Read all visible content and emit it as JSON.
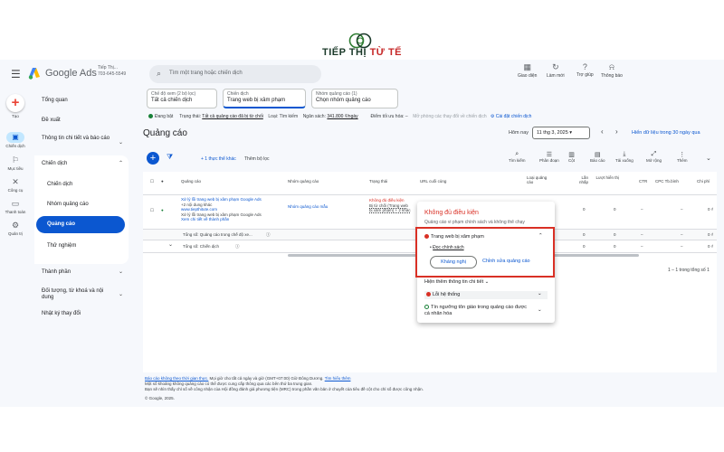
{
  "brand": {
    "name_part1": "TIẾP THỊ ",
    "name_part2": "TỪ TẾ"
  },
  "app": {
    "product_name": "Google Ads",
    "account_name": "Tiếp Thị...",
    "account_id": "703-645-5549",
    "search_placeholder": "Tìm một trang hoặc chiến dịch"
  },
  "top_tools": [
    {
      "icon": "appearance-icon",
      "glyph": "▦",
      "label": "Giao diện"
    },
    {
      "icon": "refresh-icon",
      "glyph": "↻",
      "label": "Làm mới"
    },
    {
      "icon": "help-icon",
      "glyph": "?",
      "label": "Trợ giúp"
    },
    {
      "icon": "bell-icon",
      "glyph": "🔔",
      "label": "Thông báo"
    }
  ],
  "left_rail": {
    "create": "Tạo",
    "items": [
      "Chiến dịch",
      "Mục tiêu",
      "Công cụ",
      "Thanh toán",
      "Quản trị"
    ]
  },
  "sidenav": {
    "overview": "Tổng quan",
    "recommendations": "Đề xuất",
    "insights": "Thông tin chi tiết và báo cáo",
    "campaigns": "Chiến dịch",
    "sub": [
      "Chiến dịch",
      "Nhóm quảng cáo",
      "Quảng cáo",
      "Thử nghiệm"
    ],
    "assets": "Thành phần",
    "audiences": "Đối tượng, từ khoá và nội dung",
    "change_history": "Nhật ký thay đổi"
  },
  "filters": {
    "view_label": "Chế độ xem (2 bộ lọc)",
    "view_value": "Tất cả chiến dịch",
    "campaign_label": "Chiến dịch",
    "campaign_value": "Trang web bị xâm phạm",
    "adgroup_label": "Nhóm quảng cáo (1)",
    "adgroup_value": "Chọn nhóm quảng cáo"
  },
  "status": {
    "state": "Đang bật",
    "status_label": "Trạng thái:",
    "status_value": "Tất cả quảng cáo đã bị từ chối",
    "type_label": "Loại:",
    "type_value": "Tìm kiếm",
    "budget_label": "Ngân sách:",
    "budget_value": "341.800 ₫/ngày",
    "goal_label": "Điểm tối ưu hóa:",
    "goal_value": "–",
    "change_note": "Mở phòng các thay đổi về chiến dịch",
    "settings": "Cài đặt chiến dịch"
  },
  "page": {
    "title": "Quảng cáo",
    "date_label": "Hôm nay",
    "date_value": "11 thg 3, 2025",
    "compare": "Hiển dữ liệu trong 30 ngày qua"
  },
  "toolbar": {
    "add_filter": "+ 1 thực thể khác",
    "add_filter2": "Thêm bộ lọc",
    "tools": [
      {
        "icon": "search-icon",
        "glyph": "🔍",
        "label": "Tìm kiếm"
      },
      {
        "icon": "segment-icon",
        "glyph": "☰",
        "label": "Phân đoạn"
      },
      {
        "icon": "columns-icon",
        "glyph": "▥",
        "label": "Cột"
      },
      {
        "icon": "report-icon",
        "glyph": "▤",
        "label": "Báo cáo"
      },
      {
        "icon": "download-icon",
        "glyph": "⤓",
        "label": "Tải xuống"
      },
      {
        "icon": "expand-icon",
        "glyph": "⛶",
        "label": "Mở rộng"
      },
      {
        "icon": "more-icon",
        "glyph": "⋮",
        "label": "Thêm"
      }
    ]
  },
  "table": {
    "headers": [
      "Quảng cáo",
      "Nhóm quảng cáo",
      "Trạng thái",
      "URL cuối cùng",
      "Loại quảng cáo",
      "Lần nhấp",
      "Lượt hiển thị",
      "CTR",
      "CPC Tb.bình",
      "Chi phí"
    ],
    "row": {
      "ad_line1": "Xử lý lỗi trang web bị xâm phạm Google Ads",
      "ad_line2": "+2 nội dung khác",
      "ad_line3": "www.tiepthitute.com",
      "ad_line4": "Xử lý lỗi trang web bị xâm phạm Google Ads",
      "ad_line5": "Xem chi tiết về thành phần",
      "adgroup": "Nhóm quảng cáo mẫu",
      "status_line1": "Không đủ điều kiện",
      "status_line2": "Bị từ chối (Trang web",
      "status_line3": "bị xâm phạm) + 2 khác",
      "clicks": "0",
      "impr": "0",
      "ctr": "–",
      "cpc": "–",
      "cost": "0 ₫"
    },
    "total_row1": "Tổng số: Quảng cáo trong chế độ xe...",
    "total_row2": "Tổng số: Chiến dịch",
    "pager": "1 – 1 trong tổng số 1"
  },
  "popup": {
    "title": "Không đủ điều kiện",
    "subtitle": "Quảng cáo vi phạm chính sách và không thể chạy",
    "issue1": "Trang web bị xâm phạm",
    "policy_link": "Đọc chính sách",
    "appeal": "Kháng nghị",
    "edit": "Chỉnh sửa quảng cáo",
    "more": "Hiện thêm thông tin chi tiết",
    "issue2": "Lỗi hệ thống",
    "issue3": "Tín ngưỡng tôn giáo trong quảng cáo được cá nhân hóa"
  },
  "footer": {
    "line1_link": "Báo cáo không theo thời gian thực.",
    "line1": " Mọi giờ cho tất cả ngày và giờ (GMT+07:00) Giờ Đông Dương.",
    "line1_link2": "Tìm hiểu thêm",
    "line2": "Một số khoảng không quảng cáo có thể được cung cấp thông qua các bên thứ ba trung gian.",
    "line3": "Bạn sẽ nhìn thấy chỉ số về công nhận của Hội đồng đánh giá phương tiện (MRC) trong phần văn bản ở chuyết của tiêu đề cột cho chỉ số được công nhận.",
    "line4": "© Google, 2025."
  }
}
